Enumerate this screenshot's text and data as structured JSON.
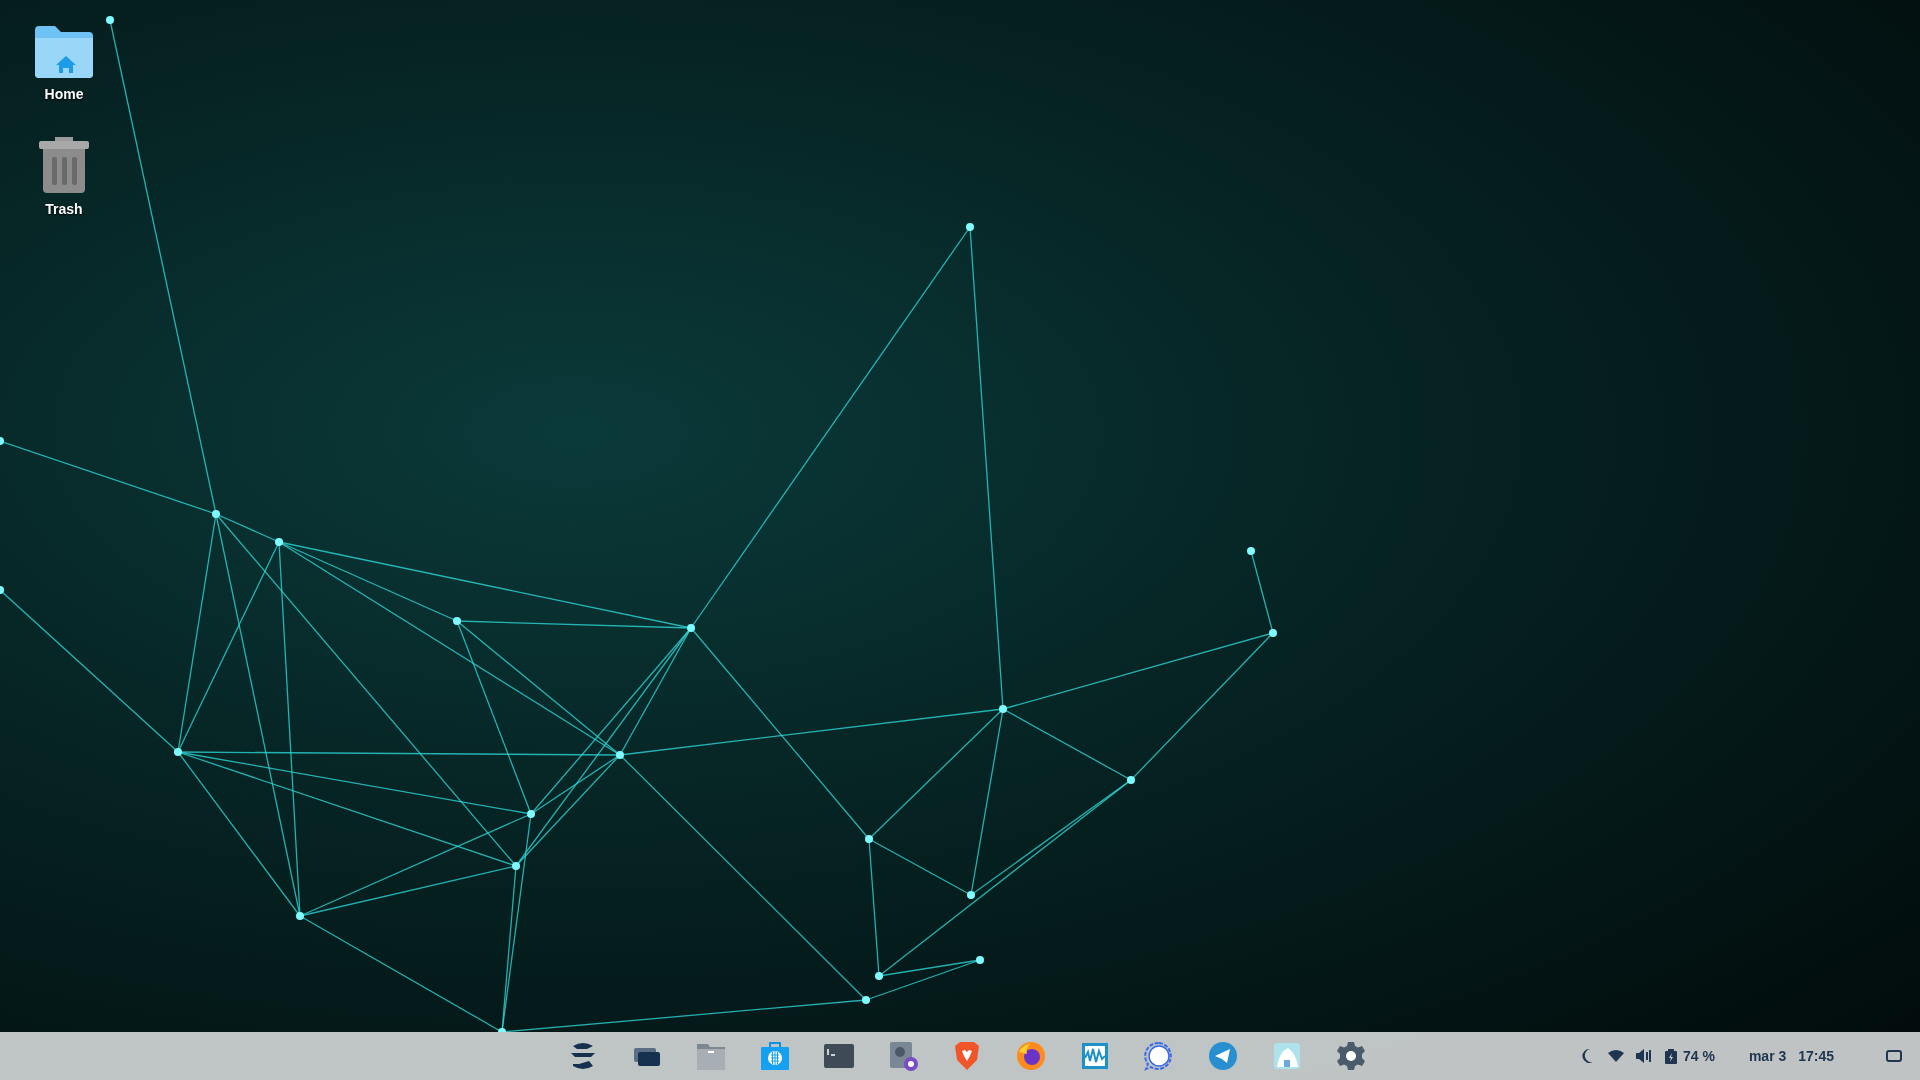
{
  "desktop_icons": [
    {
      "kind": "home",
      "label": "Home"
    },
    {
      "kind": "trash",
      "label": "Trash"
    }
  ],
  "taskbar": {
    "apps": [
      {
        "kind": "menu"
      },
      {
        "kind": "windows"
      },
      {
        "kind": "files"
      },
      {
        "kind": "store"
      },
      {
        "kind": "terminal"
      },
      {
        "kind": "disks"
      },
      {
        "kind": "brave"
      },
      {
        "kind": "firefox"
      },
      {
        "kind": "monitor"
      },
      {
        "kind": "signal"
      },
      {
        "kind": "telegram"
      },
      {
        "kind": "appimage"
      },
      {
        "kind": "settings"
      }
    ],
    "tray": {
      "battery": "74 %",
      "date": "mar 3",
      "time": "17:45"
    }
  }
}
